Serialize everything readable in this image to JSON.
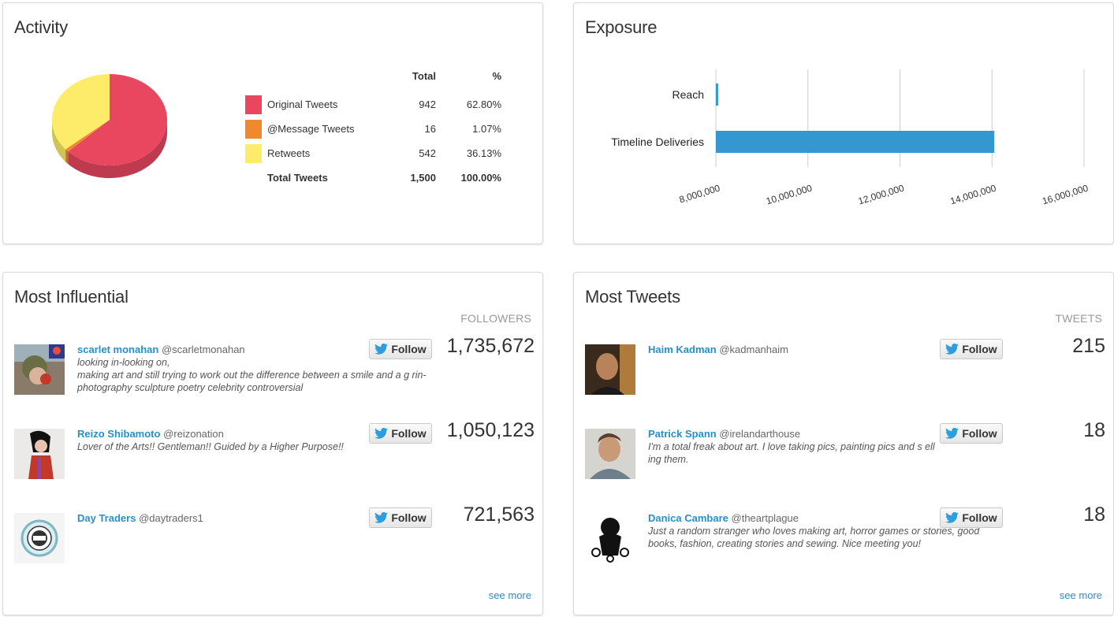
{
  "activity": {
    "title": "Activity",
    "header_total": "Total",
    "header_pct": "%",
    "rows": [
      {
        "label": "Original Tweets",
        "total": "942",
        "pct": "62.80%",
        "color": "#e8475f"
      },
      {
        "label": "@Message Tweets",
        "total": "16",
        "pct": "1.07%",
        "color": "#f0892d"
      },
      {
        "label": "Retweets",
        "total": "542",
        "pct": "36.13%",
        "color": "#fdec6a"
      }
    ],
    "total_row": {
      "label": "Total Tweets",
      "total": "1,500",
      "pct": "100.00%"
    }
  },
  "exposure": {
    "title": "Exposure"
  },
  "chart_data": [
    {
      "type": "pie",
      "title": "",
      "categories": [
        "Original Tweets",
        "@Message Tweets",
        "Retweets"
      ],
      "values": [
        942,
        16,
        542
      ],
      "colors": [
        "#e8475f",
        "#f0892d",
        "#fdec6a"
      ]
    },
    {
      "type": "bar",
      "orientation": "horizontal",
      "title": "",
      "categories": [
        "Reach",
        "Timeline Deliveries"
      ],
      "values": [
        8050000,
        14050000
      ],
      "xlim": [
        8000000,
        16000000
      ],
      "ticks": [
        "8,000,000",
        "10,000,000",
        "12,000,000",
        "14,000,000",
        "16,000,000"
      ],
      "grid": true,
      "color": "#3597cf"
    }
  ],
  "influential": {
    "title": "Most Influential",
    "column_header": "FOLLOWERS",
    "see_more": "see more",
    "users": [
      {
        "name": "scarlet monahan",
        "handle": "@scarletmonahan",
        "bio": "looking in-looking on,\nmaking art and still trying to work out the difference between a smile and a g rin-\nphotography sculpture poetry celebrity controversial",
        "follow": "Follow",
        "count": "1,735,672"
      },
      {
        "name": "Reizo Shibamoto",
        "handle": "@reizonation",
        "bio": "Lover of the Arts!! Gentleman!! Guided by a Higher Purpose!!",
        "follow": "Follow",
        "count": "1,050,123"
      },
      {
        "name": "Day Traders",
        "handle": "@daytraders1",
        "bio": "",
        "follow": "Follow",
        "count": "721,563"
      }
    ]
  },
  "tweets": {
    "title": "Most Tweets",
    "column_header": "TWEETS",
    "see_more": "see more",
    "users": [
      {
        "name": "Haim Kadman",
        "handle": "@kadmanhaim",
        "bio": "",
        "follow": "Follow",
        "count": "215"
      },
      {
        "name": "Patrick Spann",
        "handle": "@irelandarthouse",
        "bio": "I'm a total freak about art. I love taking pics, painting pics and s elling them.",
        "follow": "Follow",
        "count": "18"
      },
      {
        "name": "Danica Cambare",
        "handle": "@theartplague",
        "bio": "Just a random stranger who loves making art, horror games or stories, good books, fashion, creating stories and sewing. Nice meeting you!",
        "follow": "Follow",
        "count": "18"
      }
    ]
  }
}
